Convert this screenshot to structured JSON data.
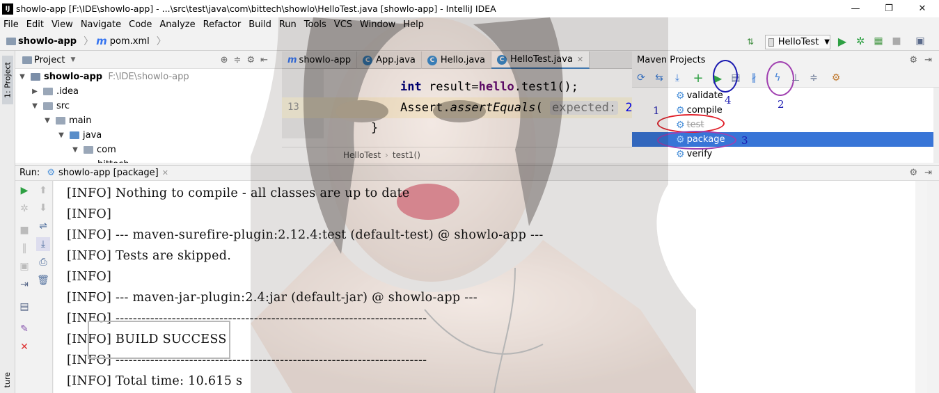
{
  "window": {
    "title": "showlo-app [F:\\IDE\\showlo-app] - ...\\src\\test\\java\\com\\bittech\\showlo\\HelloTest.java [showlo-app] - IntelliJ IDEA",
    "app_icon": "IJ",
    "minimize": "—",
    "maximize": "❐",
    "close": "✕"
  },
  "menu": [
    "File",
    "Edit",
    "View",
    "Navigate",
    "Code",
    "Analyze",
    "Refactor",
    "Build",
    "Run",
    "Tools",
    "VCS",
    "Window",
    "Help"
  ],
  "navbar": {
    "project": "showlo-app",
    "file": "pom.xml",
    "run_config": "HelloTest",
    "sort_icon": "⇅"
  },
  "sidebar": {
    "project_tab": "1: Project",
    "structure_tab": "ture"
  },
  "project_panel": {
    "title": "Project",
    "tree": [
      {
        "label": "showlo-app",
        "path": "F:\\IDE\\showlo-app"
      },
      {
        "label": ".idea"
      },
      {
        "label": "src"
      },
      {
        "label": "main"
      },
      {
        "label": "java"
      },
      {
        "label": "com"
      },
      {
        "label": "bittech"
      }
    ]
  },
  "editor": {
    "tabs": [
      "showlo-app",
      "App.java",
      "Hello.java",
      "HelloTest.java"
    ],
    "line_number": "13",
    "code": {
      "line1_kw": "int",
      "line1_rest1": " result=",
      "line1_field": "hello",
      "line1_rest2": ".test1();",
      "line2_cls": "Assert.",
      "line2_method": "assertEquals",
      "line2_paren": "(",
      "line2_hint": "expected:",
      "line2_num": " 2,",
      "line3": "}"
    },
    "breadcrumb": [
      "HelloTest",
      "test1()"
    ]
  },
  "maven": {
    "title": "Maven Projects",
    "lifecycle": [
      "validate",
      "compile",
      "test",
      "package",
      "verify"
    ],
    "selected": "package",
    "annotations": [
      "1",
      "2",
      "3",
      "4"
    ]
  },
  "run_panel": {
    "label": "Run:",
    "tab": "showlo-app [package]",
    "console_lines": [
      "[INFO] Nothing to compile - all classes are up to date",
      "[INFO]",
      "[INFO] --- maven-surefire-plugin:2.12.4:test (default-test) @ showlo-app ---",
      "[INFO] Tests are skipped.",
      "[INFO]",
      "[INFO] --- maven-jar-plugin:2.4:jar (default-jar) @ showlo-app ---",
      "[INFO] ------------------------------------------------------------------------",
      "[INFO] BUILD SUCCESS",
      "[INFO] ------------------------------------------------------------------------",
      "[INFO] Total time:  10.615 s"
    ]
  },
  "colors": {
    "accent": "#3875d7",
    "run_green": "#2ea043",
    "annot_red": "#e0202a",
    "annot_purple": "#a040b0",
    "annot_blue": "#1a1ab0"
  }
}
